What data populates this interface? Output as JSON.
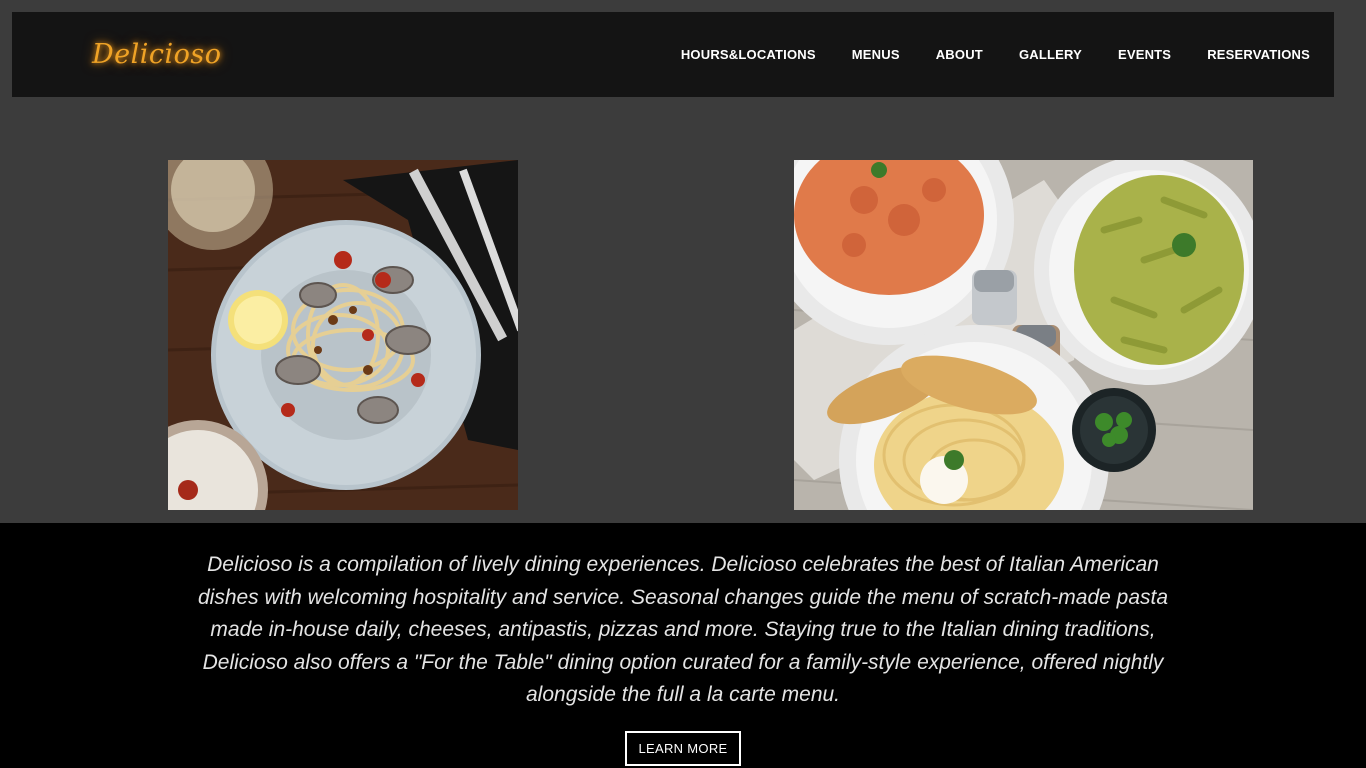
{
  "header": {
    "logo": "Delicioso",
    "nav": [
      {
        "label": "HOURS&LOCATIONS"
      },
      {
        "label": "MENUS"
      },
      {
        "label": "ABOUT"
      },
      {
        "label": "GALLERY"
      },
      {
        "label": "EVENTS"
      },
      {
        "label": "RESERVATIONS"
      }
    ]
  },
  "photos": [
    {
      "subject": "spaghetti with clams, lemon wedge, cutlery and wine glass on a wooden table"
    },
    {
      "subject": "fusilli in tomato sauce, penne pesto, spaghetti carbonara with garlic bread and salt and pepper shakers"
    }
  ],
  "about": {
    "description": "Delicioso is a compilation of lively dining experiences. Delicioso celebrates the best of Italian American dishes with welcoming hospitality and service. Seasonal changes guide the menu of scratch-made pasta made in-house daily, cheeses, antipastis, pizzas and more. Staying true to the Italian dining traditions, Delicioso also offers a \"For the Table\" dining option curated for a family-style experience, offered nightly alongside the full a la carte menu.",
    "button_label": "LEARN MORE"
  },
  "colors": {
    "page_background": "#3c3c3c",
    "header_background": "#141414",
    "band_background": "#000000",
    "logo": "#f0a326",
    "text": "#ffffff"
  }
}
